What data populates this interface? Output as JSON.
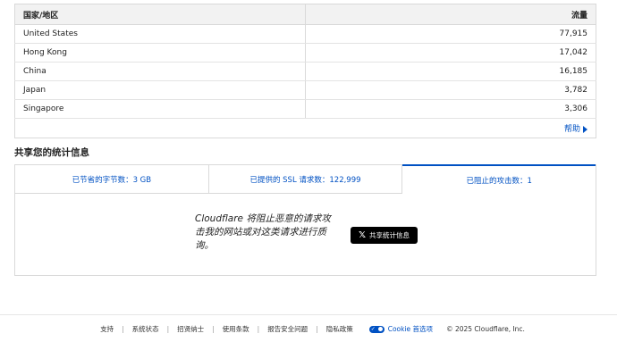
{
  "traffic_table": {
    "headers": {
      "country": "国家/地区",
      "flow": "流量"
    },
    "rows": [
      {
        "country": "United States",
        "flow": "77,915"
      },
      {
        "country": "Hong Kong",
        "flow": "17,042"
      },
      {
        "country": "China",
        "flow": "16,185"
      },
      {
        "country": "Japan",
        "flow": "3,782"
      },
      {
        "country": "Singapore",
        "flow": "3,306"
      }
    ],
    "help_label": "帮助"
  },
  "stats": {
    "title": "共享您的统计信息",
    "tabs": [
      {
        "label": "已节省的字节数：3 GB",
        "active": false
      },
      {
        "label": "已提供的 SSL 请求数：122,999",
        "active": false
      },
      {
        "label": "已阻止的攻击数：1",
        "active": true
      }
    ],
    "share_text": "Cloudflare 将阻止恶意的请求攻击我的网站或对这类请求进行质询。",
    "share_button_label": "共享统计信息",
    "share_button_icon": "x-logo-icon"
  },
  "footer": {
    "links": [
      "支持",
      "系统状态",
      "招贤纳士",
      "使用条款",
      "报告安全问题",
      "隐私政策"
    ],
    "cookie_label": "Cookie 首选项",
    "cookie_icon": "privacy-toggle-icon",
    "copyright": "© 2025 Cloudflare, Inc.",
    "accent_color": "#0051c3"
  }
}
